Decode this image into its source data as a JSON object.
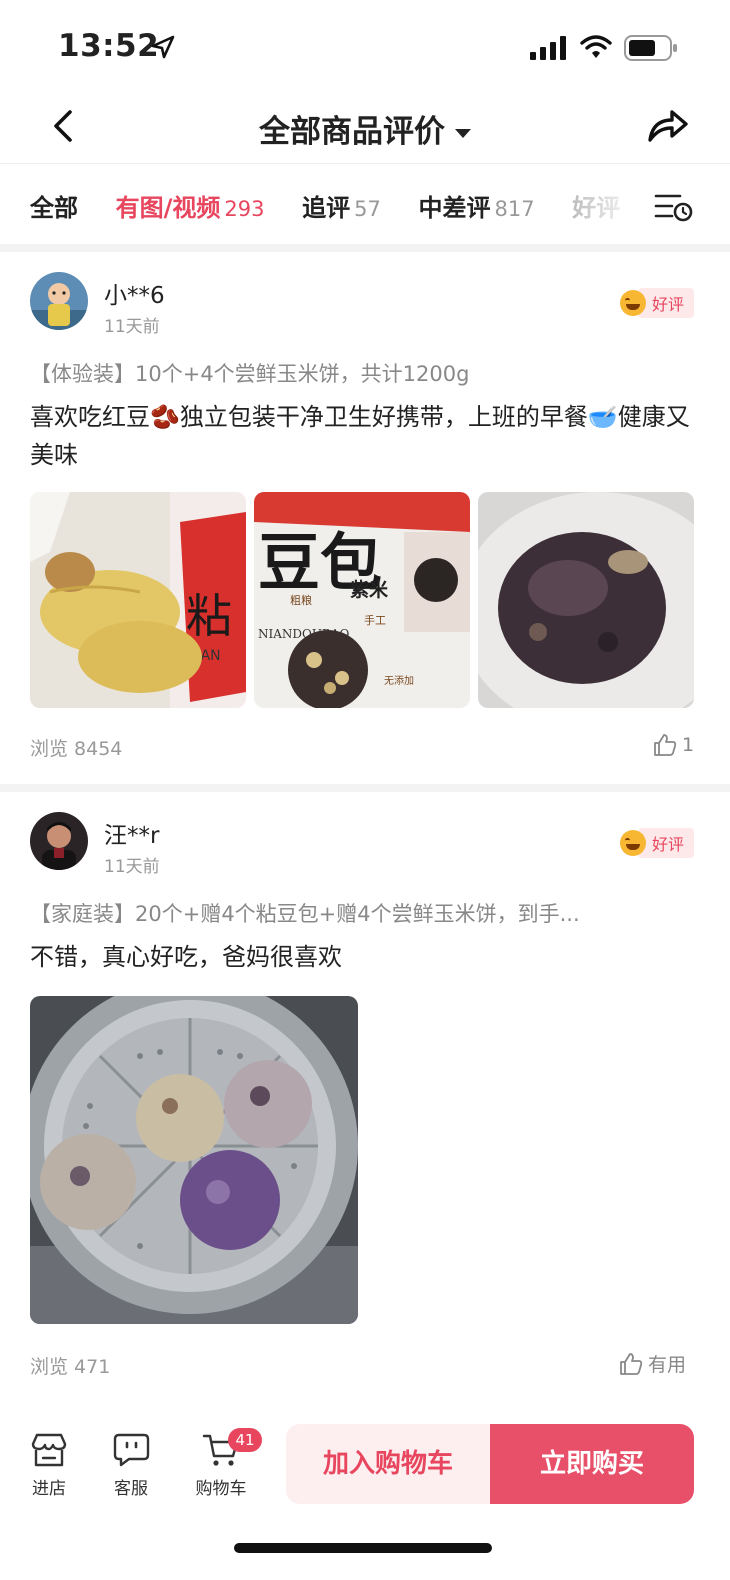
{
  "status_bar": {
    "time": "13:52"
  },
  "header": {
    "title": "全部商品评价"
  },
  "tabs": [
    {
      "label": "全部",
      "count": ""
    },
    {
      "label": "有图/视频",
      "count": "293"
    },
    {
      "label": "追评",
      "count": "57"
    },
    {
      "label": "中差评",
      "count": "817"
    },
    {
      "label": "好评",
      "count": ""
    }
  ],
  "reviews": [
    {
      "username": "小**6",
      "date": "11天前",
      "badge": "好评",
      "sku": "【体验装】10个+4个尝鲜玉米饼，共计1200g",
      "text": "喜欢吃红豆🫘独立包装干净卫生好携带，上班的早餐🥣健康又美味",
      "views": "浏览 8454",
      "likes": "1"
    },
    {
      "username": "汪**r",
      "date": "11天前",
      "badge": "好评",
      "sku": "【家庭装】20个+赠4个粘豆包+赠4个尝鲜玉米饼，到手...",
      "text": "不错，真心好吃，爸妈很喜欢",
      "views": "浏览 471",
      "likes": "有用"
    }
  ],
  "photo_text": {
    "p1_char": "粘",
    "p1_sub": "NIAN",
    "p2_title": "豆包",
    "p2_flavor": "紫米",
    "p2_tag1": "粗粮",
    "p2_tag2": "手工",
    "p2_tag3": "无添加",
    "p2_brand": "NIANDOUBAO"
  },
  "bottom_bar": {
    "store": "进店",
    "service": "客服",
    "cart": "购物车",
    "cart_count": "41",
    "add_to_cart": "加入购物车",
    "buy_now": "立即购买"
  },
  "colors": {
    "accent": "#e8465e",
    "accent_light": "#fdeef0"
  }
}
